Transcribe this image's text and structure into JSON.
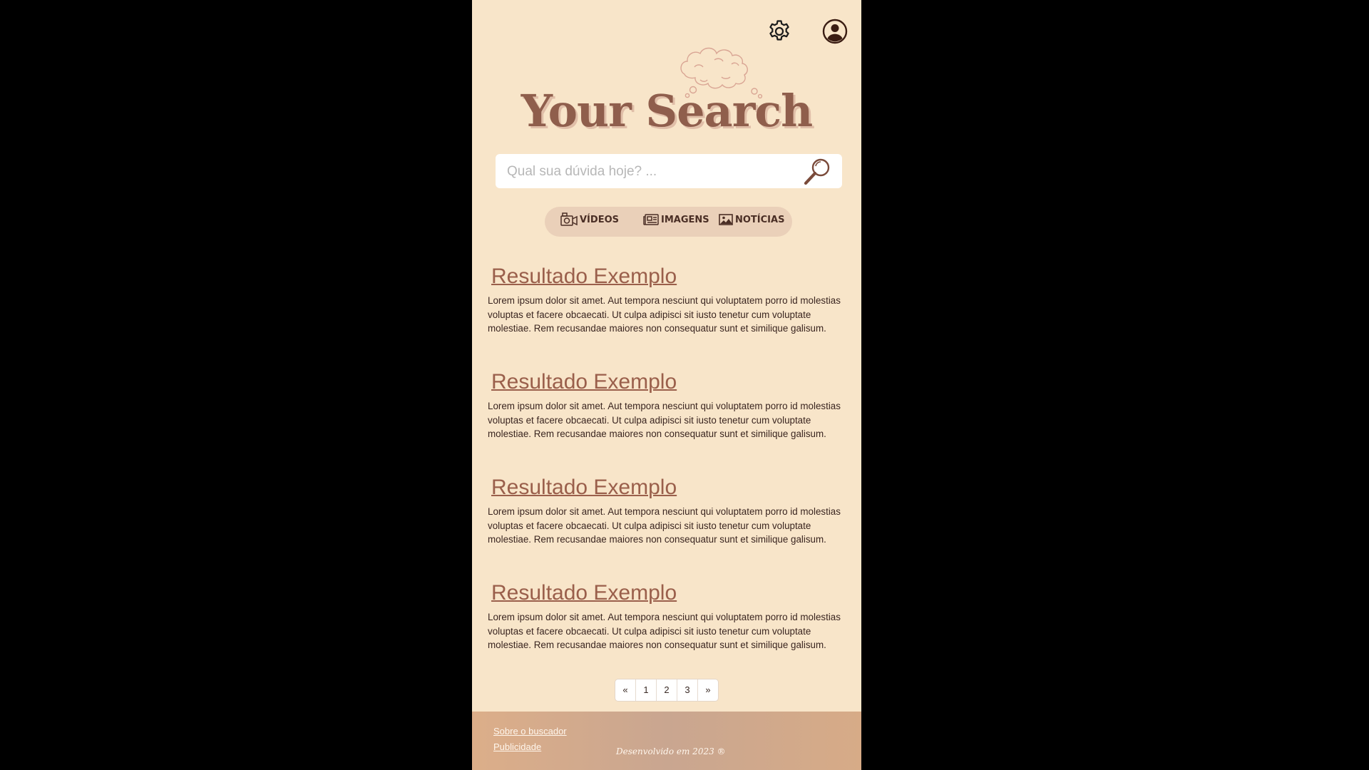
{
  "header": {
    "settings_icon": "gear-icon",
    "profile_icon": "user-circle-icon"
  },
  "logo": {
    "text": "Your Search",
    "decoration_icon": "thought-cloud-icon"
  },
  "search": {
    "placeholder": "Qual sua dúvida hoje? ...",
    "value": "",
    "button_icon": "magnifier-icon"
  },
  "tabs": [
    {
      "label": "VÍDEOS",
      "icon": "camera-icon"
    },
    {
      "label": "IMAGENS",
      "icon": "newspaper-icon"
    },
    {
      "label": "NOTÍCIAS",
      "icon": "image-icon"
    }
  ],
  "results": [
    {
      "title": "Resultado Exemplo",
      "snippet": "Lorem ipsum dolor sit amet. Aut tempora nesciunt qui voluptatem porro id molestias voluptas et facere obcaecati. Ut culpa adipisci sit iusto tenetur cum voluptate molestiae. Rem recusandae maiores non consequatur sunt et similique galisum."
    },
    {
      "title": "Resultado Exemplo",
      "snippet": "Lorem ipsum dolor sit amet. Aut tempora nesciunt qui voluptatem porro id molestias voluptas et facere obcaecati. Ut culpa adipisci sit iusto tenetur cum voluptate molestiae. Rem recusandae maiores non consequatur sunt et similique galisum."
    },
    {
      "title": "Resultado Exemplo",
      "snippet": "Lorem ipsum dolor sit amet. Aut tempora nesciunt qui voluptatem porro id molestias voluptas et facere obcaecati. Ut culpa adipisci sit iusto tenetur cum voluptate molestiae. Rem recusandae maiores non consequatur sunt et similique galisum."
    },
    {
      "title": "Resultado Exemplo",
      "snippet": "Lorem ipsum dolor sit amet. Aut tempora nesciunt qui voluptatem porro id molestias voluptas et facere obcaecati. Ut culpa adipisci sit iusto tenetur cum voluptate molestiae. Rem recusandae maiores non consequatur sunt et similique galisum."
    }
  ],
  "pagination": {
    "prev": "«",
    "pages": [
      "1",
      "2",
      "3"
    ],
    "next": "»"
  },
  "footer": {
    "links": [
      "Sobre o buscador",
      "Publicidade"
    ],
    "copyright": "Desenvolvido em 2023 ®"
  },
  "colors": {
    "background": "#f8e5c9",
    "accent": "#9a5f4b",
    "tab_bar": "#ead0b9",
    "footer": "#d7ab87",
    "outside": "#000000"
  }
}
